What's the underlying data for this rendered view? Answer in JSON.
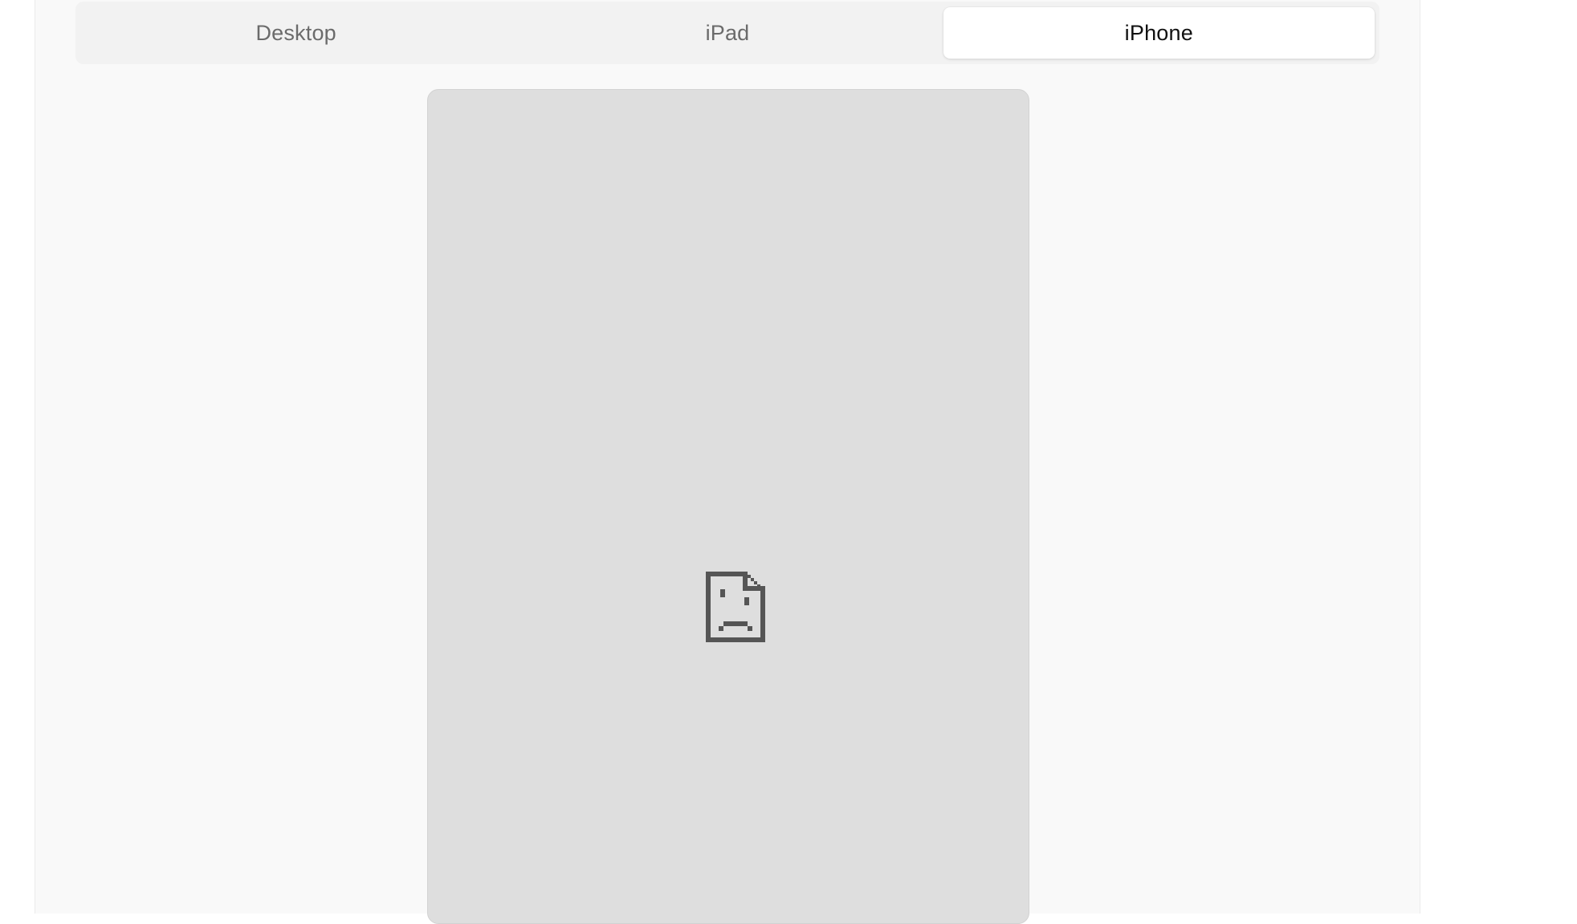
{
  "device_tabs": {
    "items": [
      {
        "label": "Desktop",
        "active": false
      },
      {
        "label": "iPad",
        "active": false
      },
      {
        "label": "iPhone",
        "active": true
      }
    ]
  },
  "preview": {
    "icon": "broken-document-icon",
    "background": "#dedede"
  },
  "colors": {
    "panel_bg": "#f9f9f9",
    "segmented_bg": "#f2f2f2",
    "active_tab_bg": "#ffffff",
    "inactive_text": "#6b6b6b",
    "active_text": "#111111",
    "icon_color": "#555555"
  }
}
